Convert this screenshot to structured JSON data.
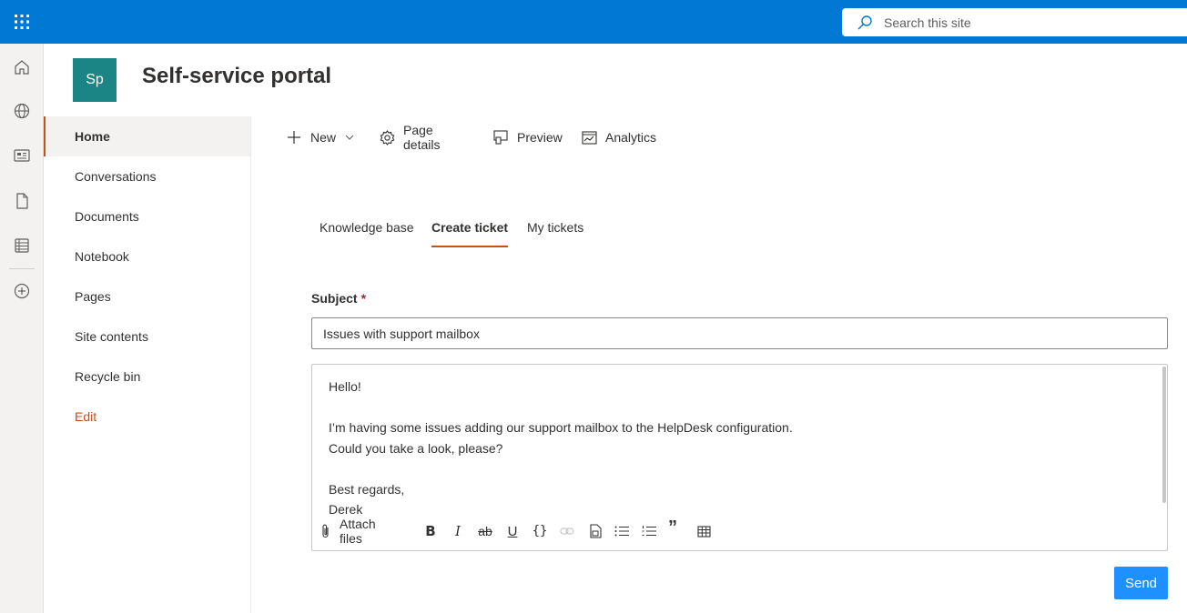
{
  "header": {
    "search_placeholder": "Search this site"
  },
  "site": {
    "logo_text": "Sp",
    "title": "Self-service portal"
  },
  "leftnav": {
    "items": [
      {
        "label": "Home"
      },
      {
        "label": "Conversations"
      },
      {
        "label": "Documents"
      },
      {
        "label": "Notebook"
      },
      {
        "label": "Pages"
      },
      {
        "label": "Site contents"
      },
      {
        "label": "Recycle bin"
      },
      {
        "label": "Edit"
      }
    ]
  },
  "commandbar": {
    "new_label": "New",
    "page_details_label": "Page details",
    "preview_label": "Preview",
    "analytics_label": "Analytics"
  },
  "tabs": [
    {
      "label": "Knowledge base"
    },
    {
      "label": "Create ticket",
      "active": true
    },
    {
      "label": "My tickets"
    }
  ],
  "form": {
    "subject_label": "Subject",
    "required_mark": "*",
    "subject_value": "Issues with support mailbox",
    "body_lines": [
      "Hello!",
      "",
      "I’m having some issues adding our support mailbox to the HelpDesk configuration.",
      "Could you take a look, please?",
      "",
      "Best regards,",
      "Derek"
    ],
    "attach_label": "Attach files",
    "send_label": "Send"
  },
  "colors": {
    "suite_bar": "#0078d4",
    "accent": "#c4501c",
    "logo_bg": "#1b8484",
    "send_button": "#1e90ff"
  }
}
